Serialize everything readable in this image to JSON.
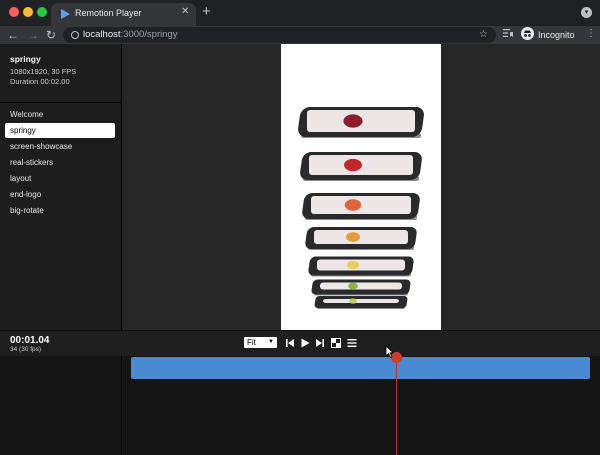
{
  "browser": {
    "tab_title": "Remotion Player",
    "url_host": "localhost",
    "url_rest": ":3000/springy",
    "profile_label": "Incognito"
  },
  "composition": {
    "name": "springy",
    "dimensions": "1080x1920, 30 FPS",
    "duration": "Duration 00:02.00"
  },
  "sidebar": {
    "items": [
      {
        "label": "Welcome"
      },
      {
        "label": "springy"
      },
      {
        "label": "screen-showcase"
      },
      {
        "label": "real-stickers"
      },
      {
        "label": "layout"
      },
      {
        "label": "end-logo"
      },
      {
        "label": "big-rotate"
      }
    ],
    "selected": "springy"
  },
  "controls": {
    "time": "00:01.04",
    "frame": "34 (30 fps)",
    "zoom_select": "Fit"
  },
  "timeline": {
    "playhead_frame": 34,
    "total_frames": 60
  },
  "phone_stack": {
    "phones": [
      {
        "screen_item": "cherry",
        "color": "#8e1f2a"
      },
      {
        "screen_item": "strawberry",
        "color": "#c2272d"
      },
      {
        "screen_item": "grapefruit",
        "color": "#e0623a"
      },
      {
        "screen_item": "orange",
        "color": "#e79a37"
      },
      {
        "screen_item": "banana",
        "color": "#e9cf5a"
      },
      {
        "screen_item": "kiwi",
        "color": "#8ab541"
      },
      {
        "screen_item": "lime",
        "color": "#b9d36a"
      }
    ]
  },
  "colors": {
    "accent_track": "#4a8ad3",
    "playhead": "#d53a2e"
  }
}
